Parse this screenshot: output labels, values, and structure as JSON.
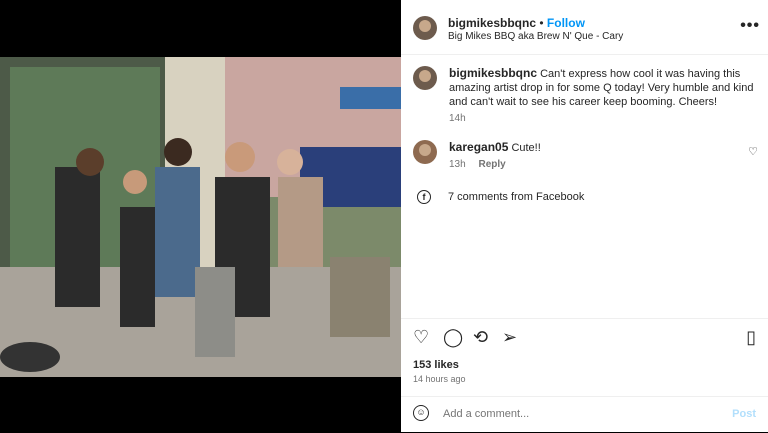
{
  "post": {
    "username": "bigmikesbbqnc",
    "follow_label": "Follow",
    "separator": "•",
    "location": "Big Mikes BBQ aka Brew N' Que - Cary",
    "more_label": "•••",
    "caption": "Can't express how cool it was having this amazing artist drop in for some Q today! Very humble and kind and can't wait to see his career keep booming. Cheers!",
    "caption_time": "14h"
  },
  "comments": [
    {
      "username": "karegan05",
      "text": "Cute!!",
      "time": "13h",
      "reply_label": "Reply"
    }
  ],
  "facebook": {
    "label": "7 comments from Facebook"
  },
  "engagement": {
    "likes": "153 likes",
    "time": "14 hours ago"
  },
  "add_comment": {
    "placeholder": "Add a comment...",
    "post_label": "Post"
  },
  "icons": {
    "like": "heart-icon",
    "comment": "comment-icon",
    "share": "repost-icon",
    "send": "send-icon",
    "save": "bookmark-icon",
    "emoji": "emoji-icon",
    "facebook": "facebook-icon"
  },
  "colors": {
    "accent": "#0095f6",
    "muted": "#737373"
  }
}
